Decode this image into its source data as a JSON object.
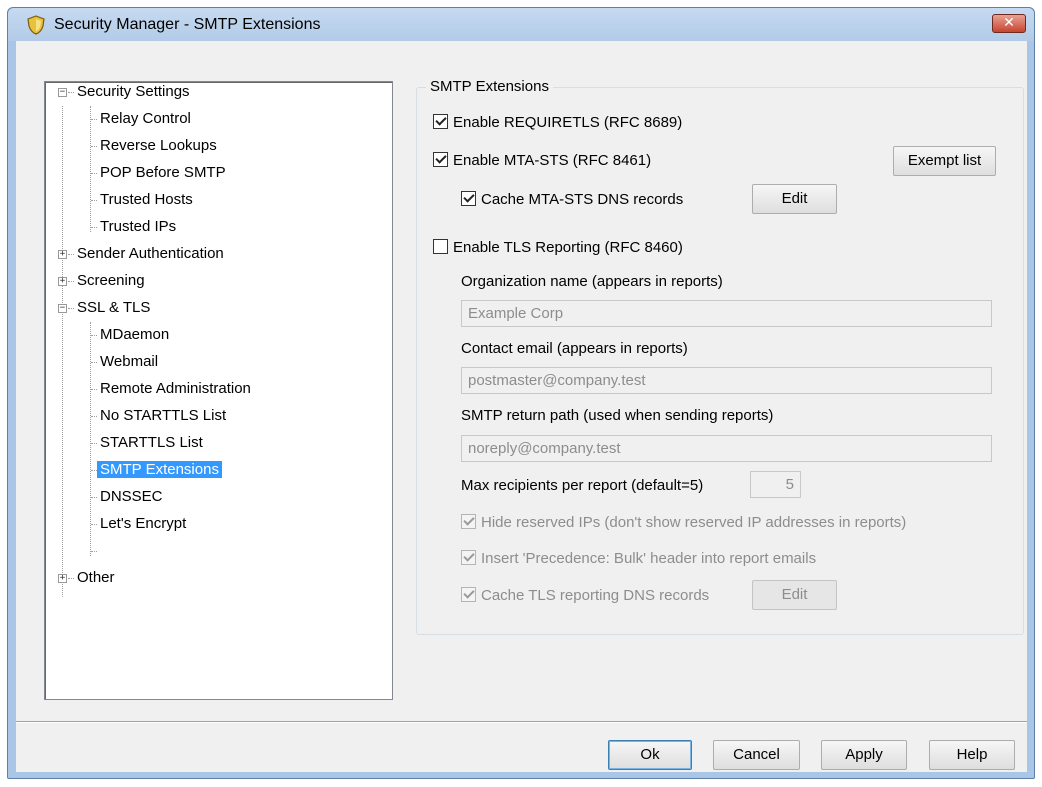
{
  "window": {
    "title": "Security Manager - SMTP Extensions",
    "close_label": "✕"
  },
  "tree": {
    "items": [
      {
        "label": "Security Settings",
        "expander": "−"
      },
      {
        "label": "Relay Control"
      },
      {
        "label": "Reverse Lookups"
      },
      {
        "label": "POP Before SMTP"
      },
      {
        "label": "Trusted Hosts"
      },
      {
        "label": "Trusted IPs"
      },
      {
        "label": "Sender Authentication",
        "expander": "+"
      },
      {
        "label": "Screening",
        "expander": "+"
      },
      {
        "label": "SSL & TLS",
        "expander": "−"
      },
      {
        "label": "MDaemon"
      },
      {
        "label": "Webmail"
      },
      {
        "label": "Remote Administration"
      },
      {
        "label": "No STARTTLS List"
      },
      {
        "label": "STARTTLS List"
      },
      {
        "label": "SMTP Extensions",
        "selected": true
      },
      {
        "label": "DNSSEC"
      },
      {
        "label": "Let's Encrypt"
      },
      {
        "label": "Other",
        "expander": "+"
      }
    ]
  },
  "smtp": {
    "group_label": "SMTP Extensions",
    "requiretls": {
      "label": "Enable REQUIRETLS (RFC 8689)",
      "checked": true
    },
    "mta_sts": {
      "label": "Enable MTA-STS (RFC 8461)",
      "checked": true
    },
    "exempt_list_label": "Exempt list",
    "cache_mta_sts": {
      "label": "Cache MTA-STS DNS records",
      "checked": true
    },
    "edit_label": "Edit",
    "tls_reporting": {
      "label": "Enable TLS Reporting (RFC 8460)",
      "checked": false
    },
    "org_name_label": "Organization name (appears in reports)",
    "org_name_value": "Example Corp",
    "contact_email_label": "Contact email (appears in reports)",
    "contact_email_value": "postmaster@company.test",
    "return_path_label": "SMTP return path (used when sending reports)",
    "return_path_value": "noreply@company.test",
    "max_recipients_label": "Max recipients per report (default=5)",
    "max_recipients_value": "5",
    "hide_reserved": {
      "label": "Hide reserved IPs (don't show reserved IP addresses in reports)",
      "checked": true
    },
    "precedence_bulk": {
      "label": "Insert 'Precedence: Bulk' header into report emails",
      "checked": true
    },
    "cache_tls_reporting": {
      "label": "Cache TLS reporting DNS records",
      "checked": true
    },
    "edit2_label": "Edit"
  },
  "footer": {
    "ok_label": "Ok",
    "cancel_label": "Cancel",
    "apply_label": "Apply",
    "help_label": "Help"
  }
}
